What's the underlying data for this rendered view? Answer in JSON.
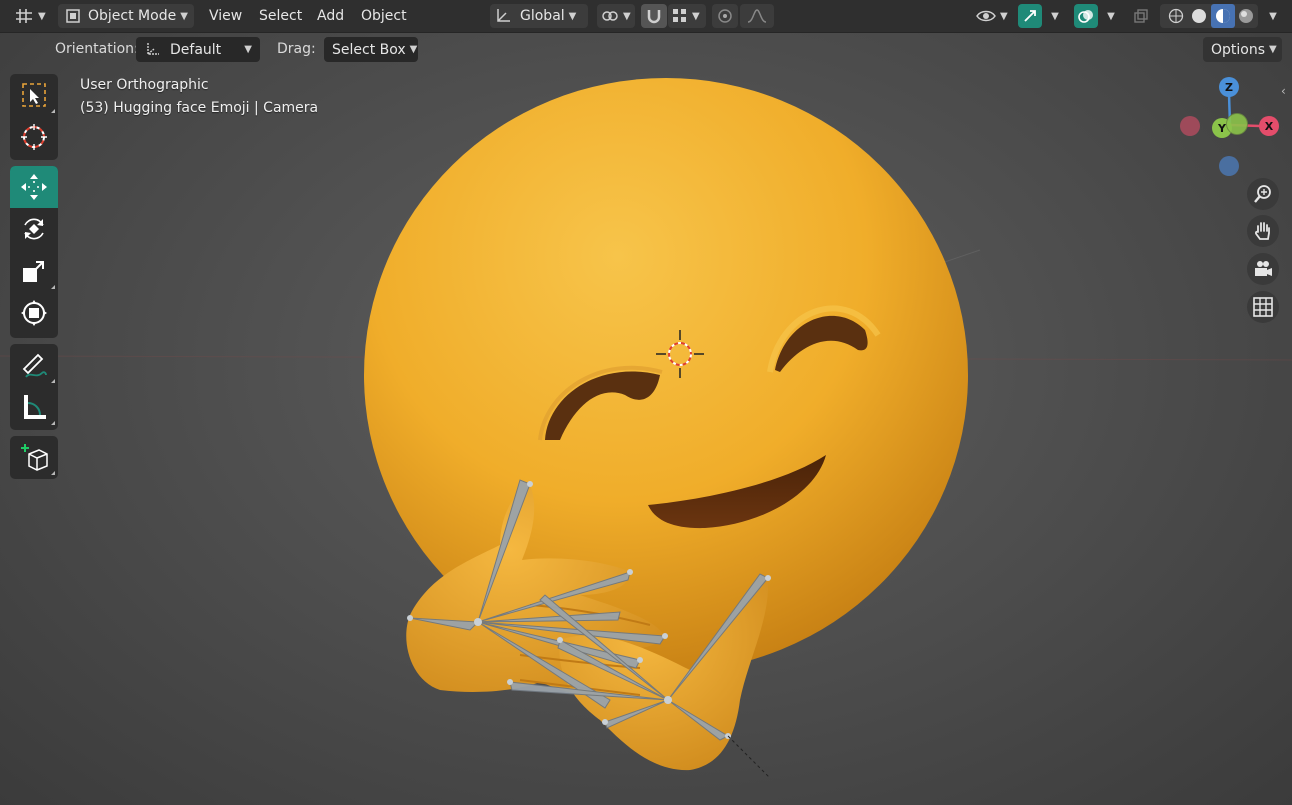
{
  "header": {
    "editor_type_icon": "viewport-editor-icon",
    "mode_label": "Object Mode",
    "menus": {
      "view": "View",
      "select": "Select",
      "add": "Add",
      "object": "Object"
    },
    "transform_orientation": "Global",
    "options_label": "Options"
  },
  "tool_settings": {
    "orientation_label": "Orientation:",
    "orientation_value": "Default",
    "drag_label": "Drag:",
    "drag_value": "Select Box"
  },
  "viewport_overlay": {
    "view_name": "User Orthographic",
    "object_info": "(53) Hugging face Emoji | Camera"
  },
  "navigation_gizmo": {
    "z": "Z",
    "y": "Y",
    "x": "X"
  },
  "toolbar_tools": [
    "select-box-icon",
    "cursor-icon",
    "move-icon",
    "rotate-icon",
    "scale-icon",
    "transform-icon",
    "annotate-icon",
    "measure-icon",
    "add-cube-icon"
  ],
  "colors": {
    "active_tool": "#1f8a78",
    "axis_x": "#e44d6b",
    "axis_y": "#8bc34a",
    "axis_z": "#4a90d9",
    "emoji_body": "#f2b233"
  }
}
